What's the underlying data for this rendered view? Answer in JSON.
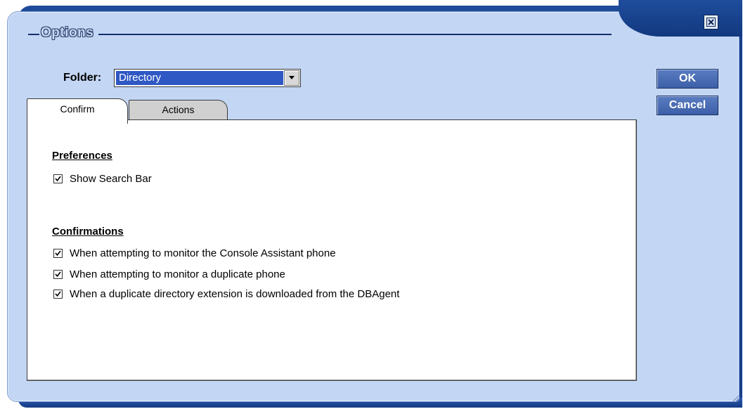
{
  "window": {
    "title": "Options"
  },
  "folder": {
    "label": "Folder:",
    "selected": "Directory"
  },
  "tabs": [
    {
      "label": "Confirm",
      "active": true
    },
    {
      "label": "Actions",
      "active": false
    }
  ],
  "preferences": {
    "heading": "Preferences",
    "items": [
      {
        "label": "Show Search Bar",
        "checked": true
      }
    ]
  },
  "confirmations": {
    "heading": "Confirmations",
    "items": [
      {
        "label": "When attempting to monitor the Console Assistant phone",
        "checked": true
      },
      {
        "label": "When attempting to monitor a duplicate phone",
        "checked": true
      },
      {
        "label": "When a duplicate directory extension is downloaded from the DBAgent",
        "checked": true
      }
    ]
  },
  "buttons": {
    "ok": "OK",
    "cancel": "Cancel"
  },
  "icons": {
    "close": "close-icon",
    "dropdown": "chevron-down-icon",
    "check": "check-icon"
  },
  "colors": {
    "frame": "#1f4c9c",
    "panel": "#c3d6f4",
    "selection": "#2f58c4",
    "button": "#4a6cb4"
  }
}
